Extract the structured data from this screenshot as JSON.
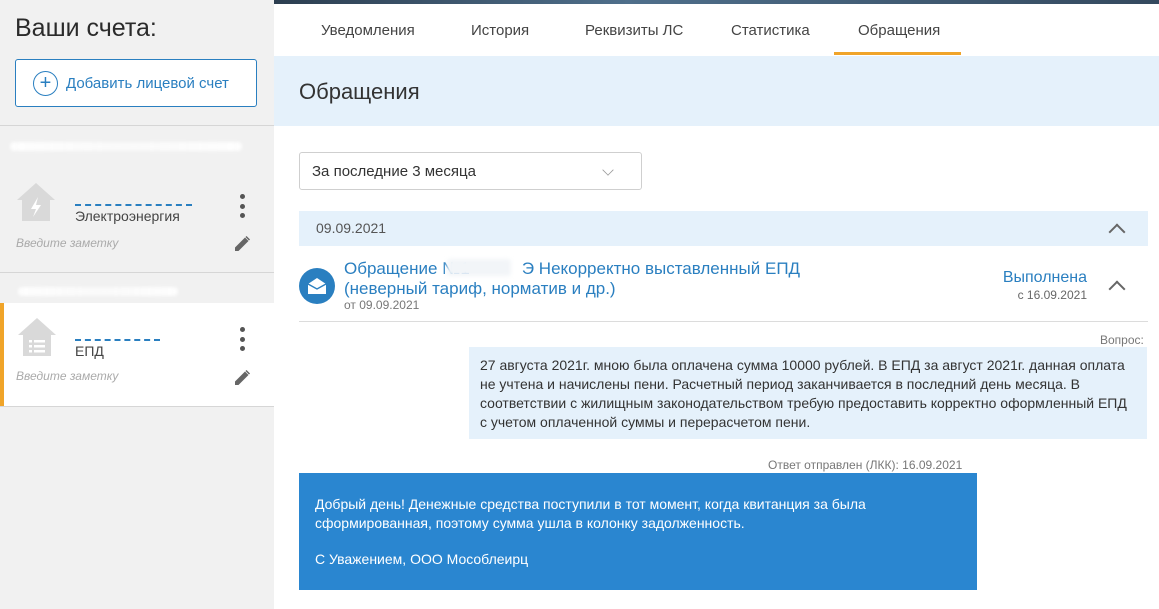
{
  "sidebar": {
    "title": "Ваши счета:",
    "add_account_label": "Добавить лицевой счет",
    "accounts": [
      {
        "type": "Электроэнергия",
        "note_placeholder": "Введите заметку",
        "icon": "lightning-house-icon"
      },
      {
        "type": "ЕПД",
        "note_placeholder": "Введите заметку",
        "icon": "list-house-icon"
      }
    ]
  },
  "tabs": [
    {
      "label": "Уведомления"
    },
    {
      "label": "История"
    },
    {
      "label": "Реквизиты ЛС"
    },
    {
      "label": "Статистика"
    },
    {
      "label": "Обращения",
      "active": true
    }
  ],
  "page_title": "Обращения",
  "period_filter": {
    "selected": "За последние 3 месяца"
  },
  "group": {
    "date": "09.09.2021",
    "ticket": {
      "title_prefix": "Обращение №1",
      "title_rest": "Э Некорректно выставленный ЕПД (неверный тариф, норматив и др.)",
      "created": "от 09.09.2021",
      "status": "Выполнена",
      "status_since": "с 16.09.2021"
    },
    "question_label": "Вопрос:",
    "question_text": "27 августа 2021г. мною была оплачена сумма 10000 рублей. В ЕПД за август 2021г. данная оплата не учтена и начислены пени. Расчетный период заканчивается в последний день месяца. В соответствии с жилищным законодательством требую предоставить корректно оформленный ЕПД с учетом оплаченной суммы и перерасчетом пени.",
    "answer_label": "Ответ отправлен (ЛКК): 16.09.2021",
    "answer_text": "Добрый день! Денежные средства поступили в тот момент, когда квитанция за  была сформированная, поэтому сумма ушла в колонку задолженность.",
    "answer_sign": "С Уважением, ООО Мособлеирц"
  },
  "colors": {
    "accent": "#2a7fc0",
    "tab_active": "#f0a429",
    "answer_bg": "#2a86d0",
    "light_bg": "#e5f1fb"
  }
}
